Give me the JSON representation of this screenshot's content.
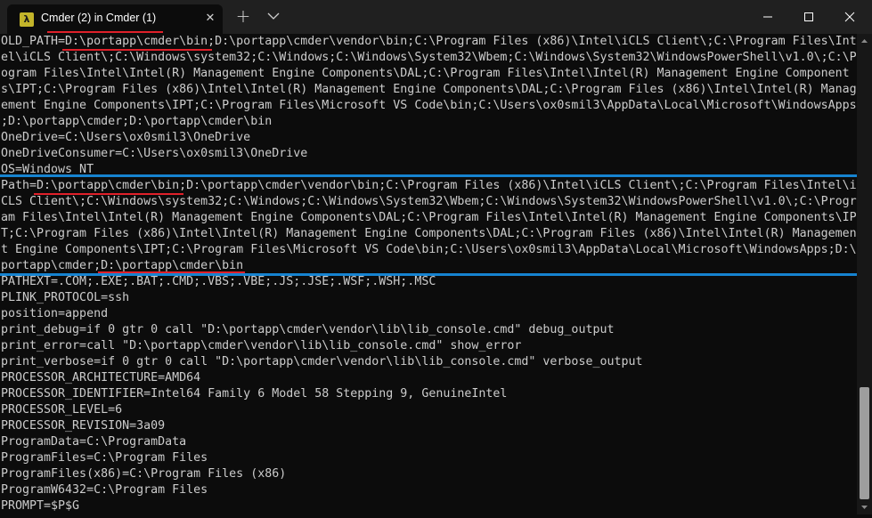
{
  "tab": {
    "icon_glyph": "λ",
    "title": "Cmder (2) in Cmder (1)",
    "close_glyph": "✕"
  },
  "titlebar": {
    "new_tab_glyph": "+"
  },
  "terminal": {
    "lines": [
      "OLD_PATH=D:\\portapp\\cmder\\bin;D:\\portapp\\cmder\\vendor\\bin;C:\\Program Files (x86)\\Intel\\iCLS Client\\;C:\\Program Files\\Int",
      "el\\iCLS Client\\;C:\\Windows\\system32;C:\\Windows;C:\\Windows\\System32\\Wbem;C:\\Windows\\System32\\WindowsPowerShell\\v1.0\\;C:\\Pr",
      "ogram Files\\Intel\\Intel(R) Management Engine Components\\DAL;C:\\Program Files\\Intel\\Intel(R) Management Engine Component",
      "s\\IPT;C:\\Program Files (x86)\\Intel\\Intel(R) Management Engine Components\\DAL;C:\\Program Files (x86)\\Intel\\Intel(R) Manag",
      "ement Engine Components\\IPT;C:\\Program Files\\Microsoft VS Code\\bin;C:\\Users\\ox0smil3\\AppData\\Local\\Microsoft\\WindowsApps",
      ";D:\\portapp\\cmder;D:\\portapp\\cmder\\bin",
      "OneDrive=C:\\Users\\ox0smil3\\OneDrive",
      "OneDriveConsumer=C:\\Users\\ox0smil3\\OneDrive",
      "OS=Windows_NT",
      "Path=D:\\portapp\\cmder\\bin;D:\\portapp\\cmder\\vendor\\bin;C:\\Program Files (x86)\\Intel\\iCLS Client\\;C:\\Program Files\\Intel\\i",
      "CLS Client\\;C:\\Windows\\system32;C:\\Windows;C:\\Windows\\System32\\Wbem;C:\\Windows\\System32\\WindowsPowerShell\\v1.0\\;C:\\Progr",
      "am Files\\Intel\\Intel(R) Management Engine Components\\DAL;C:\\Program Files\\Intel\\Intel(R) Management Engine Components\\IP",
      "T;C:\\Program Files (x86)\\Intel\\Intel(R) Management Engine Components\\DAL;C:\\Program Files (x86)\\Intel\\Intel(R) Managemen",
      "t Engine Components\\IPT;C:\\Program Files\\Microsoft VS Code\\bin;C:\\Users\\ox0smil3\\AppData\\Local\\Microsoft\\WindowsApps;D:\\",
      "portapp\\cmder;D:\\portapp\\cmder\\bin",
      "PATHEXT=.COM;.EXE;.BAT;.CMD;.VBS;.VBE;.JS;.JSE;.WSF;.WSH;.MSC",
      "PLINK_PROTOCOL=ssh",
      "position=append",
      "print_debug=if 0 gtr 0 call \"D:\\portapp\\cmder\\vendor\\lib\\lib_console.cmd\" debug_output",
      "print_error=call \"D:\\portapp\\cmder\\vendor\\lib\\lib_console.cmd\" show_error",
      "print_verbose=if 0 gtr 0 call \"D:\\portapp\\cmder\\vendor\\lib\\lib_console.cmd\" verbose_output",
      "PROCESSOR_ARCHITECTURE=AMD64",
      "PROCESSOR_IDENTIFIER=Intel64 Family 6 Model 58 Stepping 9, GenuineIntel",
      "PROCESSOR_LEVEL=6",
      "PROCESSOR_REVISION=3a09",
      "ProgramData=C:\\ProgramData",
      "ProgramFiles=C:\\Program Files",
      "ProgramFiles(x86)=C:\\Program Files (x86)",
      "ProgramW6432=C:\\Program Files",
      "PROMPT=$P$G"
    ]
  },
  "scrollbar": {
    "position_fraction": 0.75
  },
  "colors": {
    "tab_underline": "#e0202a",
    "highlight_rule": "#1683d0",
    "path_underline": "#e0202a",
    "background": "#0c0c0c",
    "text": "#cccccc"
  }
}
